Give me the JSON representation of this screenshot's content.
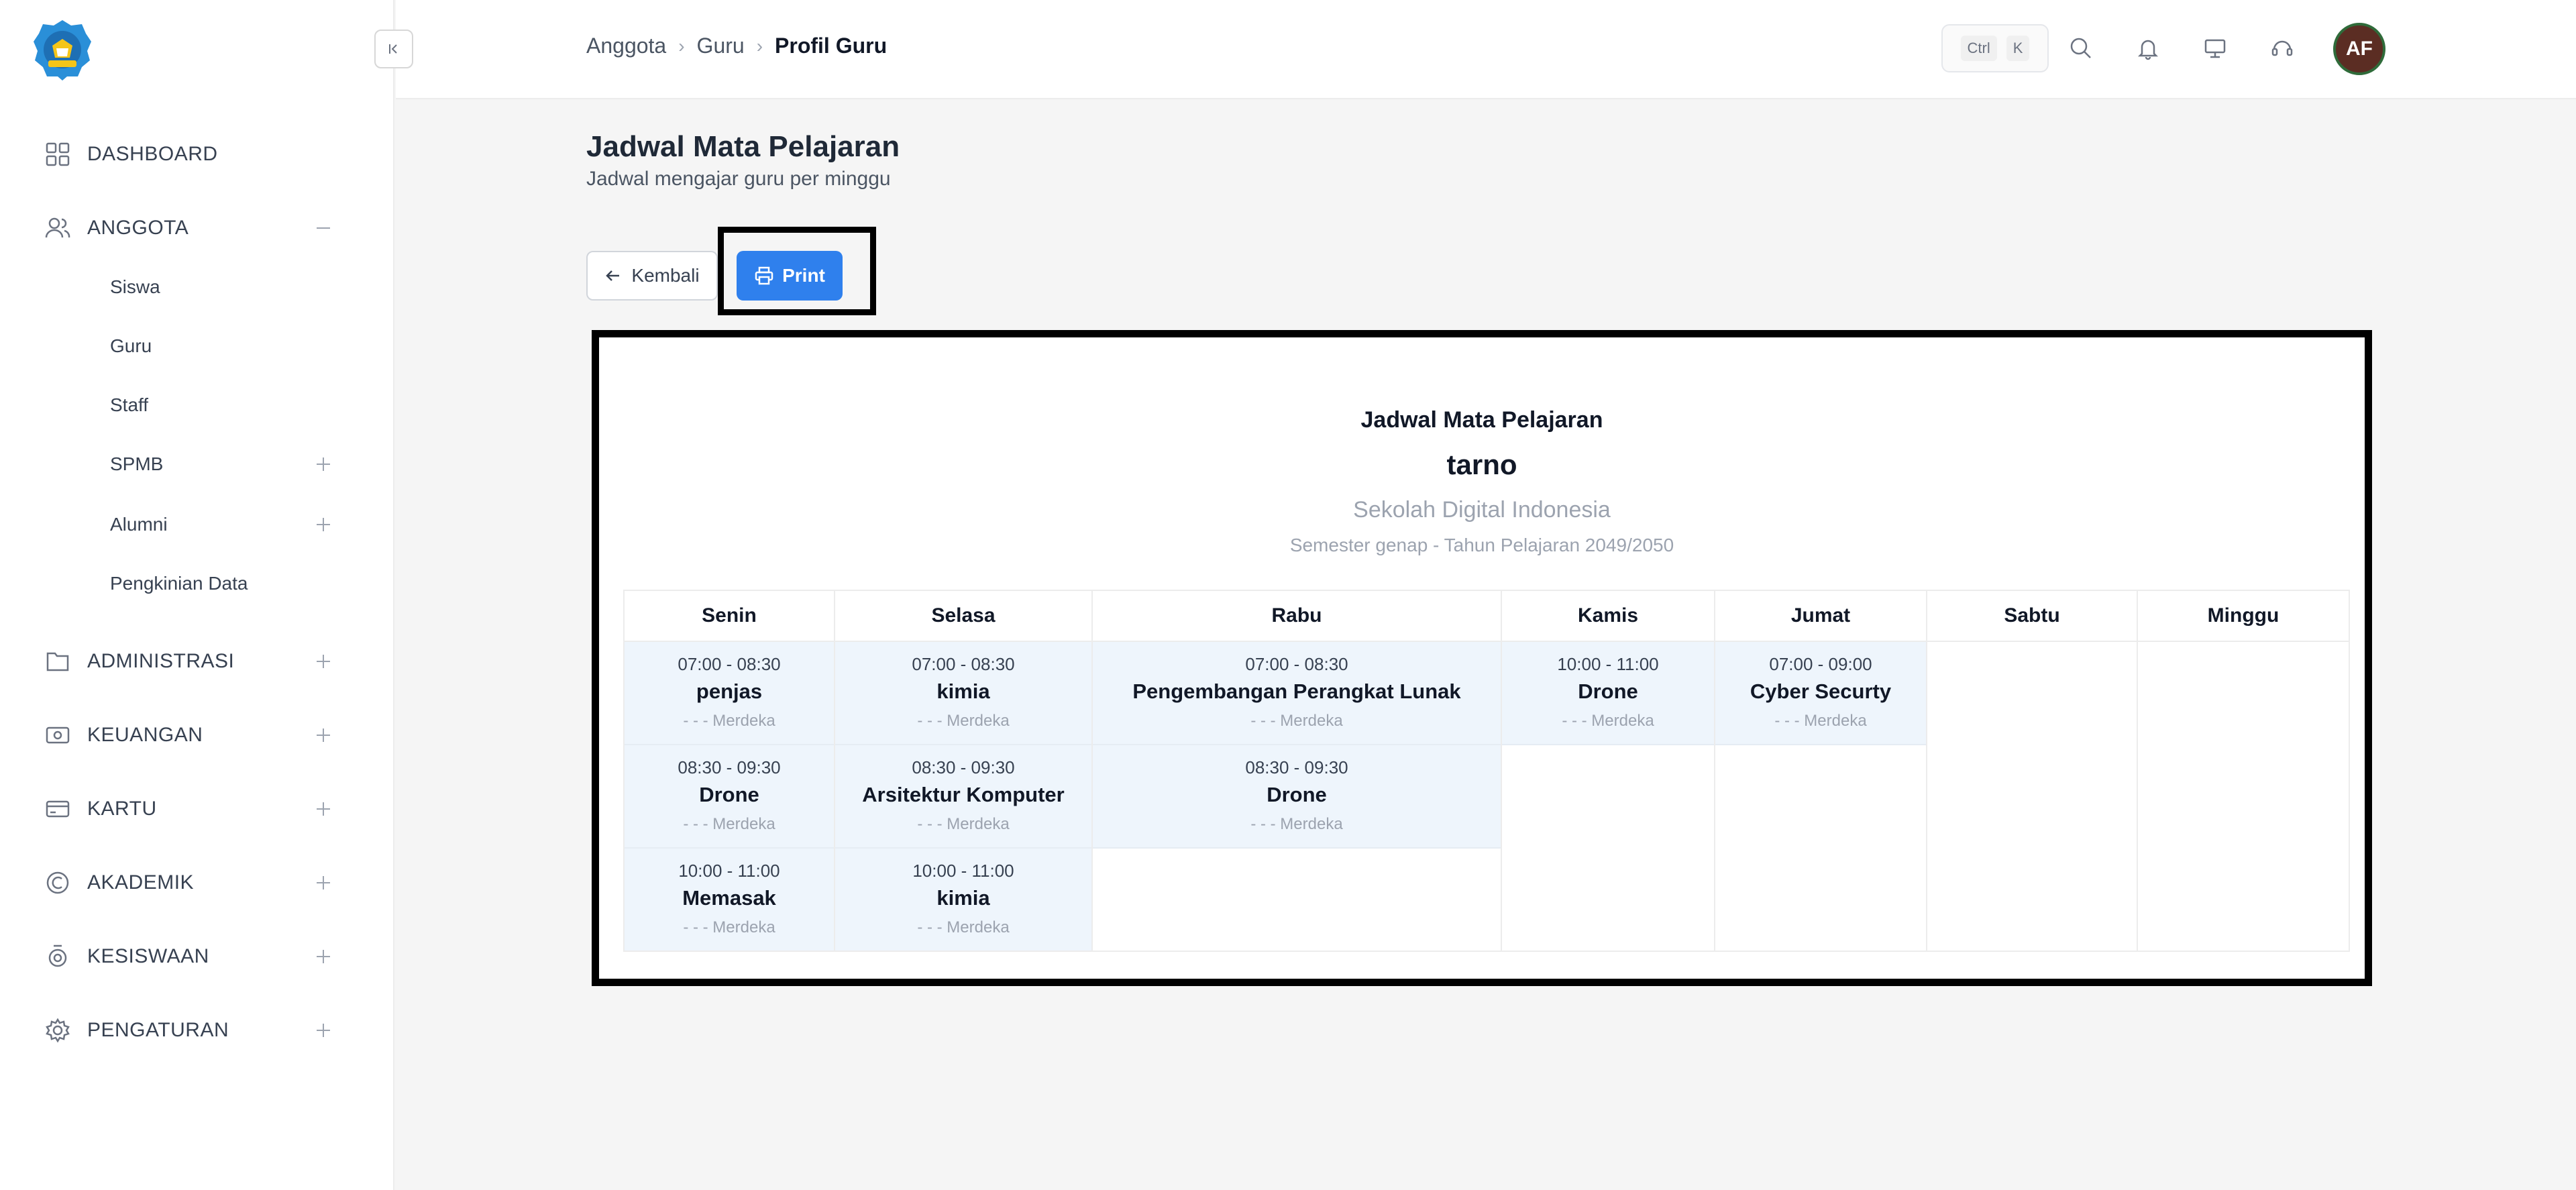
{
  "sidebar": {
    "items": [
      {
        "label": "DASHBOARD",
        "icon": "dashboard-icon",
        "toggle": ""
      },
      {
        "label": "ANGGOTA",
        "icon": "users-icon",
        "toggle": "minus"
      },
      {
        "label": "ADMINISTRASI",
        "icon": "folder-icon",
        "toggle": "plus"
      },
      {
        "label": "KEUANGAN",
        "icon": "money-icon",
        "toggle": "plus"
      },
      {
        "label": "KARTU",
        "icon": "card-icon",
        "toggle": "plus"
      },
      {
        "label": "AKADEMIK",
        "icon": "academic-icon",
        "toggle": "plus"
      },
      {
        "label": "KESISWAAN",
        "icon": "badge-icon",
        "toggle": "plus"
      },
      {
        "label": "PENGATURAN",
        "icon": "gear-icon",
        "toggle": "plus"
      }
    ],
    "sub_items": [
      {
        "label": "Siswa",
        "toggle": ""
      },
      {
        "label": "Guru",
        "toggle": ""
      },
      {
        "label": "Staff",
        "toggle": ""
      },
      {
        "label": "SPMB",
        "toggle": "plus"
      },
      {
        "label": "Alumni",
        "toggle": "plus"
      },
      {
        "label": "Pengkinian Data",
        "toggle": ""
      }
    ]
  },
  "header": {
    "breadcrumb": [
      "Anggota",
      "Guru",
      "Profil Guru"
    ],
    "shortcut": [
      "Ctrl",
      "K"
    ],
    "avatar_initials": "AF",
    "icons": [
      "search-icon",
      "bell-icon",
      "monitor-icon",
      "support-icon"
    ]
  },
  "main": {
    "title": "Jadwal Mata Pelajaran",
    "subtitle": "Jadwal mengajar guru per minggu",
    "back_label": "Kembali",
    "print_label": "Print"
  },
  "schedule": {
    "title": "Jadwal Mata Pelajaran",
    "teacher": "tarno",
    "school": "Sekolah Digital Indonesia",
    "semester": "Semester genap - Tahun Pelajaran 2049/2050",
    "days": [
      {
        "name": "Senin",
        "entries": [
          {
            "time": "07:00 - 08:30",
            "subject": "penjas",
            "curriculum": "- - - Merdeka"
          },
          {
            "time": "08:30 - 09:30",
            "subject": "Drone",
            "curriculum": "- - - Merdeka"
          },
          {
            "time": "10:00 - 11:00",
            "subject": "Memasak",
            "curriculum": "- - - Merdeka"
          }
        ]
      },
      {
        "name": "Selasa",
        "entries": [
          {
            "time": "07:00 - 08:30",
            "subject": "kimia",
            "curriculum": "- - - Merdeka"
          },
          {
            "time": "08:30 - 09:30",
            "subject": "Arsitektur Komputer",
            "curriculum": "- - - Merdeka"
          },
          {
            "time": "10:00 - 11:00",
            "subject": "kimia",
            "curriculum": "- - - Merdeka"
          }
        ]
      },
      {
        "name": "Rabu",
        "entries": [
          {
            "time": "07:00 - 08:30",
            "subject": "Pengembangan Perangkat Lunak",
            "curriculum": "- - - Merdeka"
          },
          {
            "time": "08:30 - 09:30",
            "subject": "Drone",
            "curriculum": "- - - Merdeka"
          }
        ]
      },
      {
        "name": "Kamis",
        "entries": [
          {
            "time": "10:00 - 11:00",
            "subject": "Drone",
            "curriculum": "- - - Merdeka"
          }
        ]
      },
      {
        "name": "Jumat",
        "entries": [
          {
            "time": "07:00 - 09:00",
            "subject": "Cyber Securty",
            "curriculum": "- - - Merdeka"
          }
        ]
      },
      {
        "name": "Sabtu",
        "entries": []
      },
      {
        "name": "Minggu",
        "entries": []
      }
    ]
  }
}
